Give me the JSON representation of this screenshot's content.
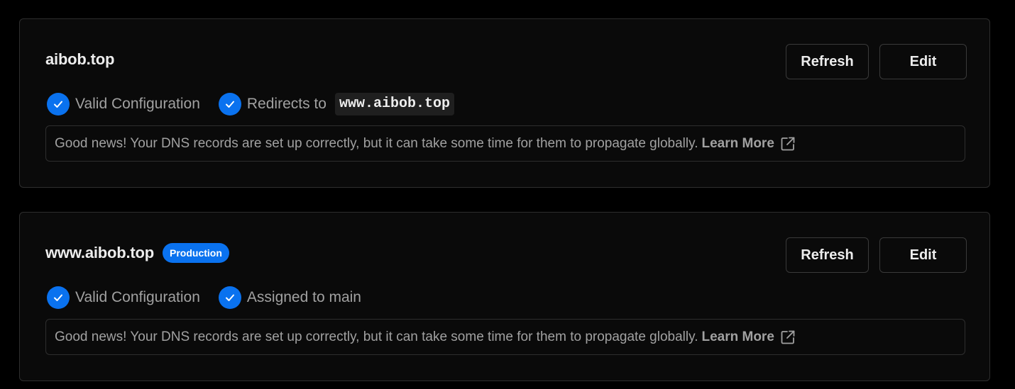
{
  "domains": [
    {
      "name": "aibob.top",
      "badge": null,
      "actions": {
        "refresh_label": "Refresh",
        "edit_label": "Edit"
      },
      "statuses": [
        {
          "label": "Valid Configuration",
          "icon": "check-circle-icon"
        },
        {
          "label": "Redirects to",
          "value": "www.aibob.top",
          "icon": "check-circle-icon"
        }
      ],
      "info": {
        "message": "Good news! Your DNS records are set up correctly, but it can take some time for them to propagate globally.",
        "link_label": "Learn More",
        "link_icon": "external-link-icon"
      }
    },
    {
      "name": "www.aibob.top",
      "badge": "Production",
      "actions": {
        "refresh_label": "Refresh",
        "edit_label": "Edit"
      },
      "statuses": [
        {
          "label": "Valid Configuration",
          "icon": "check-circle-icon"
        },
        {
          "label": "Assigned to main",
          "icon": "check-circle-icon"
        }
      ],
      "info": {
        "message": "Good news! Your DNS records are set up correctly, but it can take some time for them to propagate globally.",
        "link_label": "Learn More",
        "link_icon": "external-link-icon"
      }
    }
  ],
  "colors": {
    "accent": "#0a72ef",
    "background": "#000000",
    "card": "#0a0a0a",
    "border": "#2e2e2e",
    "text_primary": "#ededed",
    "text_secondary": "#a1a1a1"
  }
}
